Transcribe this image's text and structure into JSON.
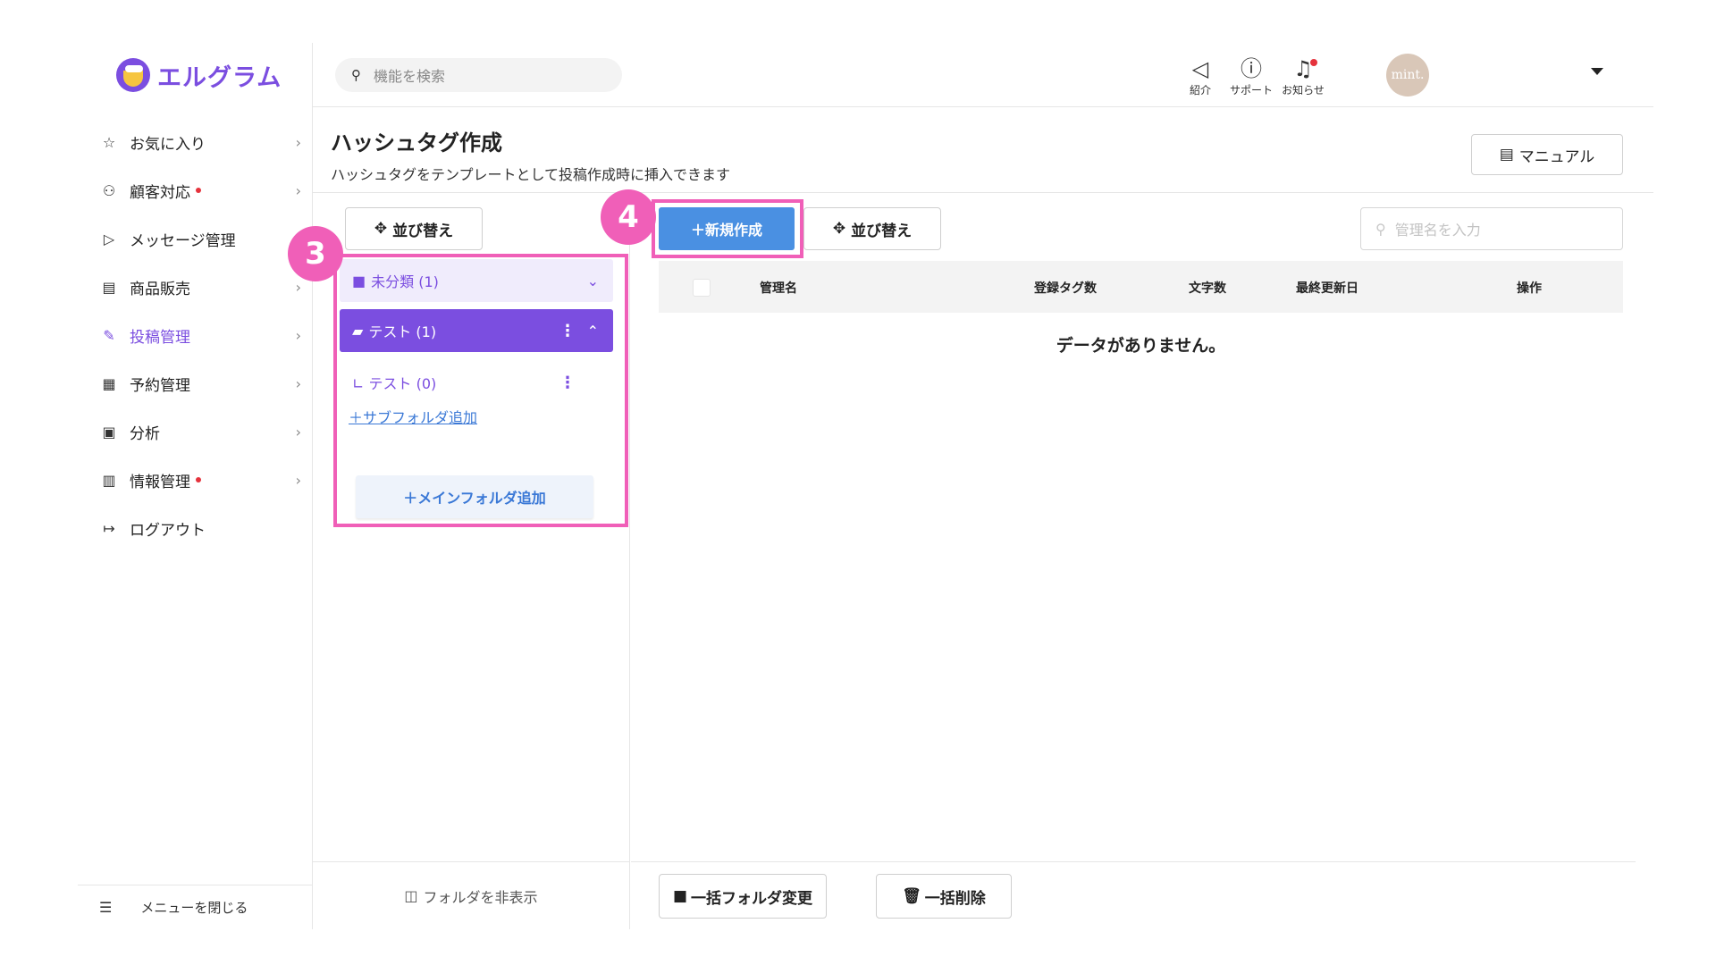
{
  "app": {
    "logo_text": "エルグラム"
  },
  "sidebar": {
    "items": [
      {
        "label": "お気に入り",
        "icon": "star-icon",
        "glyph": "☆",
        "dot": false,
        "active": false
      },
      {
        "label": "顧客対応",
        "icon": "user-icon",
        "glyph": "⚇",
        "dot": true,
        "active": false
      },
      {
        "label": "メッセージ管理",
        "icon": "send-icon",
        "glyph": "▷",
        "dot": false,
        "active": false
      },
      {
        "label": "商品販売",
        "icon": "shop-icon",
        "glyph": "▤",
        "dot": false,
        "active": false
      },
      {
        "label": "投稿管理",
        "icon": "edit-icon",
        "glyph": "✎",
        "dot": false,
        "active": true
      },
      {
        "label": "予約管理",
        "icon": "calendar-icon",
        "glyph": "▦",
        "dot": false,
        "active": false
      },
      {
        "label": "分析",
        "icon": "report-icon",
        "glyph": "▣",
        "dot": false,
        "active": false
      },
      {
        "label": "情報管理",
        "icon": "bar-chart-icon",
        "glyph": "▥",
        "dot": true,
        "active": false
      },
      {
        "label": "ログアウト",
        "icon": "logout-icon",
        "glyph": "↦",
        "dot": false,
        "active": false
      }
    ],
    "footer_label": "メニューを閉じる"
  },
  "header": {
    "search_placeholder": "機能を検索",
    "intro_label": "紹介",
    "support_label": "サポート",
    "notice_label": "お知らせ",
    "avatar_text": "mint."
  },
  "page": {
    "title": "ハッシュタグ作成",
    "subtitle": "ハッシュタグをテンプレートとして投稿作成時に挿入できます",
    "manual_label": "マニュアル"
  },
  "folders": {
    "sort_label": "並び替え",
    "items": [
      {
        "label": "未分類 (1)"
      },
      {
        "label": "テスト (1)"
      }
    ],
    "subfolder": {
      "label": "∟ テスト (0)"
    },
    "add_subfolder_label": "＋サブフォルダ追加",
    "add_main_folder_label": "＋メインフォルダ追加",
    "hide_label": "フォルダを非表示"
  },
  "main": {
    "new_label": "＋新規作成",
    "sort_label": "並び替え",
    "search_placeholder": "管理名を入力",
    "columns": [
      "管理名",
      "登録タグ数",
      "文字数",
      "最終更新日",
      "操作"
    ],
    "empty_message": "データがありません。",
    "bulk_folder_label": "一括フォルダ変更",
    "bulk_delete_label": "一括削除"
  },
  "annotations": {
    "badge3": "3",
    "badge4": "4"
  },
  "colors": {
    "accent": "#7b4ee0",
    "primary_button": "#4a90e2",
    "highlight": "#f05fb8",
    "dot": "#e5323c"
  }
}
